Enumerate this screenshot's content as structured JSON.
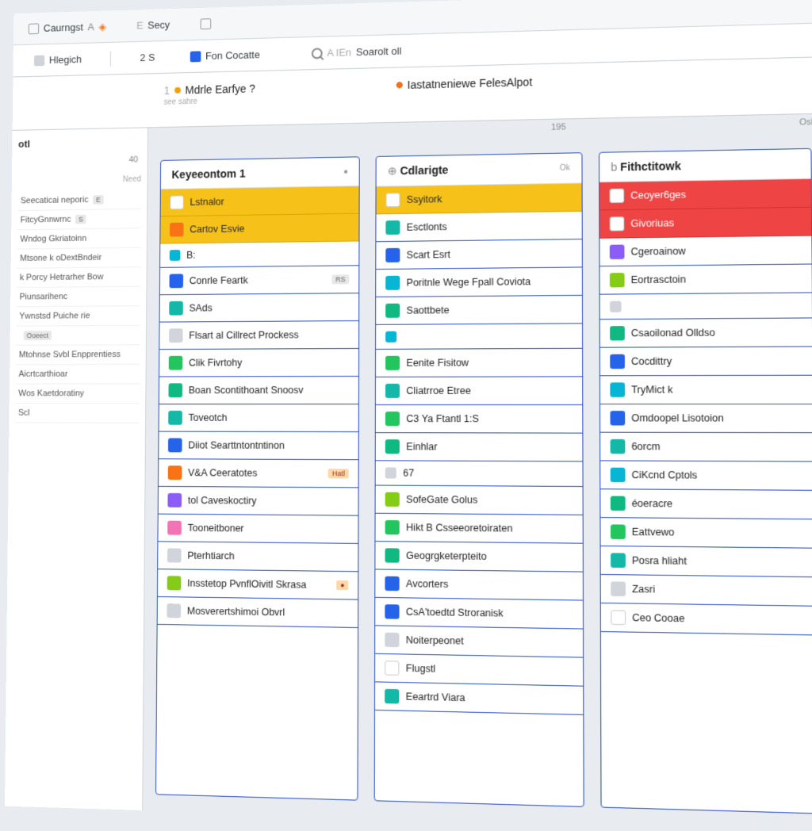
{
  "topbar": {
    "item1_icon": "e",
    "item1": "Caurngst",
    "item1_suffix": "A",
    "item2_prefix": "E",
    "item2": "Secy",
    "item3_icon": "o"
  },
  "toolbar": {
    "item1": "Hlegich",
    "item2": "2 S",
    "item3": "Fon Cocatte",
    "search_placeholder": "A IEn",
    "search_label": "Soarolt oll"
  },
  "tabs": {
    "tab1_prefix": "1",
    "tab1": "Mdrle Earfye ?",
    "tab1_sub": "see sahre",
    "tab2": "Iastatneniewe FelesAlpot"
  },
  "sidebar": {
    "header": "otl",
    "count": "40",
    "hint": "Need",
    "items": [
      {
        "label": "Seecaticai neporic",
        "tag": "E"
      },
      {
        "label": "FitcyGnnwrnc",
        "tag": "S"
      },
      {
        "label": "Wndog Gkriatoinn"
      },
      {
        "label": "Mtsone k  oDextBndeir"
      },
      {
        "label": "k Porcy   Hetrarher Bow"
      },
      {
        "label": "Piunsarihenc"
      },
      {
        "label": "Ywnstsd Puiche rie"
      },
      {
        "label": "",
        "tag": "Ooeect"
      },
      {
        "label": "Mtohnse Svbl Enpprentiess"
      },
      {
        "label": "Aicrtcarthioar"
      },
      {
        "label": "Wos Kaetdoratiny"
      },
      {
        "label": "Scl"
      }
    ]
  },
  "board": {
    "meta_top": "195",
    "meta_right": "Osh",
    "columns": [
      {
        "title": "Keyeeontom 1",
        "meta": "●",
        "cards": [
          {
            "type": "yellow",
            "icon": "c-white",
            "label": "Lstnalor"
          },
          {
            "type": "yellow",
            "icon": "c-orange",
            "label": "Cartov Esvie"
          },
          {
            "icon": "c-cyan",
            "label": "B:",
            "small": true
          },
          {
            "icon": "c-blue",
            "label": "Conrle Feartk",
            "badge": "RS"
          },
          {
            "icon": "c-teal",
            "label": "SAds"
          },
          {
            "icon": "c-gray",
            "label": "Flsart al Cillrect Prockess"
          },
          {
            "icon": "c-green",
            "label": "Clik Fivrtohy"
          },
          {
            "icon": "c-emerald",
            "label": "Boan Scontithoant Snoosv"
          },
          {
            "icon": "c-teal",
            "label": "Toveotch"
          },
          {
            "icon": "c-blue",
            "label": "Diiot Searttntontntinon"
          },
          {
            "icon": "c-orange",
            "label": "V&A Ceeratotes",
            "badge": "Hatl",
            "badgeClass": "or"
          },
          {
            "icon": "c-purple",
            "label": "tol Caveskoctiry"
          },
          {
            "icon": "c-pink",
            "label": "Tooneitboner"
          },
          {
            "icon": "c-gray",
            "label": "Pterhtiarch"
          },
          {
            "icon": "c-lime",
            "label": "Insstetop PvnflOivitl Skrasa",
            "badge": "●",
            "badgeClass": "or"
          },
          {
            "icon": "c-gray",
            "label": "Mosverertshimoi Obvrl"
          }
        ]
      },
      {
        "title": "Cdlarigte",
        "title_prefix": "⊕",
        "meta": "Ok",
        "cards": [
          {
            "type": "yellow",
            "icon": "c-white",
            "label": "Ssyitork"
          },
          {
            "icon": "c-teal",
            "label": "Esctlonts"
          },
          {
            "icon": "c-blue",
            "label": "Scart Esrt"
          },
          {
            "icon": "c-cyan",
            "label": "Poritnle Wege Fpall  Coviota"
          },
          {
            "icon": "c-emerald",
            "label": "Saottbete"
          },
          {
            "icon": "c-cyan",
            "label": "",
            "small": true
          },
          {
            "icon": "c-green",
            "label": "Eenite Fisitow"
          },
          {
            "icon": "c-teal",
            "label": "Cliatrroe Etree"
          },
          {
            "icon": "c-green",
            "label": "C3 Ya Ftantl  1:S"
          },
          {
            "icon": "c-emerald",
            "label": "Einhlar"
          },
          {
            "icon": "c-gray",
            "label": "67",
            "small": true
          },
          {
            "icon": "c-lime",
            "label": "SofeGate Golus"
          },
          {
            "icon": "c-green",
            "label": "Hikt B Csseeoretoiraten"
          },
          {
            "icon": "c-emerald",
            "label": "Geogrgketerpteito"
          },
          {
            "icon": "c-blue",
            "label": "Avcorters"
          },
          {
            "icon": "c-blue",
            "label": "CsA'toedtd Stroranisk"
          },
          {
            "icon": "c-gray",
            "label": "Noiterpeonet"
          },
          {
            "icon": "c-white",
            "label": "Flugstl"
          },
          {
            "icon": "c-teal",
            "label": "Eeartrd Viara"
          }
        ]
      },
      {
        "title": "Fithctitowk",
        "title_prefix": "b",
        "cards": [
          {
            "type": "red",
            "icon": "c-white",
            "label": "Ceoyer6ges"
          },
          {
            "type": "red",
            "icon": "c-white",
            "label": "Givoriuas"
          },
          {
            "icon": "c-purple",
            "label": "Cgeroainow"
          },
          {
            "icon": "c-lime",
            "label": "Eortrasctoin"
          },
          {
            "icon": "c-gray",
            "label": "",
            "small": true
          },
          {
            "icon": "c-emerald",
            "label": "Csaoilonad Olldso"
          },
          {
            "icon": "c-blue",
            "label": "Cocdittry"
          },
          {
            "icon": "c-cyan",
            "label": "TryMict k"
          },
          {
            "icon": "c-blue",
            "label": "Omdoopel Lisotoion"
          },
          {
            "icon": "c-teal",
            "label": "6orcm"
          },
          {
            "icon": "c-cyan",
            "label": "CiKcnd Cptols"
          },
          {
            "icon": "c-emerald",
            "label": "éoeracre"
          },
          {
            "icon": "c-green",
            "label": "Eattvewo"
          },
          {
            "icon": "c-teal",
            "label": "Posra hliaht"
          },
          {
            "icon": "c-gray",
            "label": "Zasri"
          },
          {
            "icon": "c-white",
            "label": "Ceo Cooae"
          }
        ]
      }
    ]
  }
}
